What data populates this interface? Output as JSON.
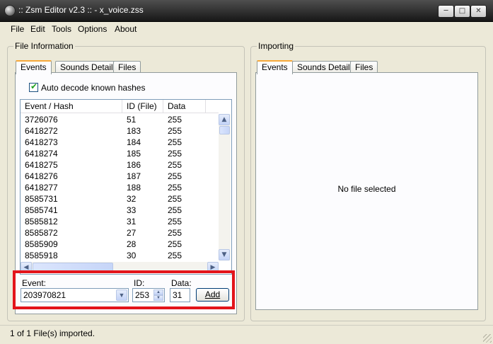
{
  "window": {
    "title": ":: Zsm Editor v2.3 :: - x_voice.zss"
  },
  "menu": [
    "File",
    "Edit",
    "Tools",
    "Options",
    "About"
  ],
  "file_info": {
    "group_label": "File Information",
    "tabs": [
      "Events",
      "Sounds Details",
      "Files"
    ],
    "active_tab": "Events",
    "auto_decode_label": "Auto decode known hashes",
    "auto_decode_checked": true,
    "columns": [
      "Event / Hash",
      "ID (File)",
      "Data"
    ],
    "rows": [
      [
        "3726076",
        "51",
        "255"
      ],
      [
        "6418272",
        "183",
        "255"
      ],
      [
        "6418273",
        "184",
        "255"
      ],
      [
        "6418274",
        "185",
        "255"
      ],
      [
        "6418275",
        "186",
        "255"
      ],
      [
        "6418276",
        "187",
        "255"
      ],
      [
        "6418277",
        "188",
        "255"
      ],
      [
        "8585731",
        "32",
        "255"
      ],
      [
        "8585741",
        "33",
        "255"
      ],
      [
        "8585812",
        "31",
        "255"
      ],
      [
        "8585872",
        "27",
        "255"
      ],
      [
        "8585909",
        "28",
        "255"
      ],
      [
        "8585918",
        "30",
        "255"
      ]
    ],
    "event_label": "Event:",
    "event_value": "203970821",
    "id_label": "ID:",
    "id_value": "253",
    "data_label": "Data:",
    "data_value": "31",
    "add_label": "Add"
  },
  "importing": {
    "group_label": "Importing",
    "tabs": [
      "Events",
      "Sounds Details",
      "Files"
    ],
    "active_tab": "Events",
    "empty_text": "No file selected"
  },
  "status": {
    "text": "1 of 1 File(s) imported."
  },
  "colors": {
    "highlight": "#e3141a",
    "tab_accent": "#f7a93a",
    "checkmark": "#21a121"
  }
}
